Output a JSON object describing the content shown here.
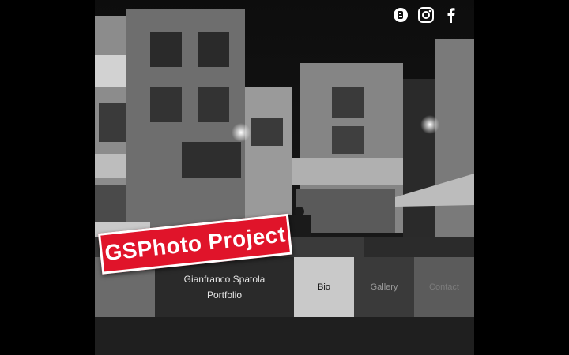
{
  "social": {
    "icons": [
      "blogger-icon",
      "instagram-icon",
      "facebook-icon"
    ]
  },
  "banner": {
    "text": "GSPhoto Project",
    "color": "#e0142a"
  },
  "info": {
    "name": "Gianfranco Spatola",
    "subtitle": "Portfolio"
  },
  "nav": {
    "bio": "Bio",
    "gallery": "Gallery",
    "contact": "Contact"
  }
}
